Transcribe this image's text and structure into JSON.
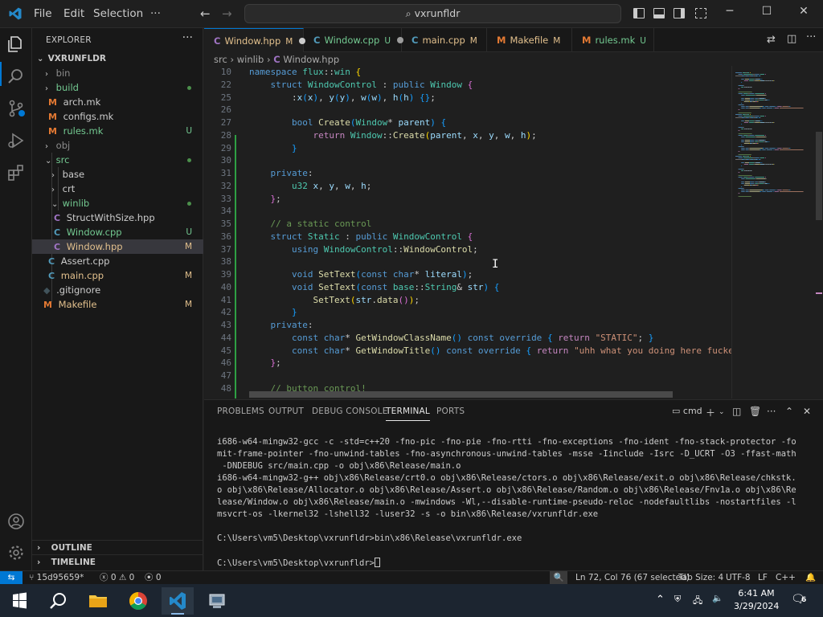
{
  "titlebar": {
    "menu": [
      "File",
      "Edit",
      "Selection",
      "···"
    ],
    "search": "vxrunfldr"
  },
  "sidebar": {
    "header": "EXPLORER",
    "root": "VXRUNFLDR",
    "items": [
      {
        "label": "bin",
        "kind": "folder",
        "state": "ignored",
        "badge": ""
      },
      {
        "label": "build",
        "kind": "folder",
        "state": "new",
        "badge": "dot"
      },
      {
        "label": "arch.mk",
        "kind": "file",
        "state": "plain",
        "badge": ""
      },
      {
        "label": "configs.mk",
        "kind": "file",
        "state": "plain",
        "badge": ""
      },
      {
        "label": "rules.mk",
        "kind": "file",
        "state": "new",
        "badge": "U"
      },
      {
        "label": "obj",
        "kind": "folder",
        "state": "ignored",
        "badge": ""
      },
      {
        "label": "src",
        "kind": "folder",
        "state": "new",
        "badge": "dot"
      },
      {
        "label": "base",
        "kind": "folder",
        "state": "plain",
        "badge": ""
      },
      {
        "label": "crt",
        "kind": "folder",
        "state": "plain",
        "badge": ""
      },
      {
        "label": "winlib",
        "kind": "folder",
        "state": "new",
        "badge": "dot"
      },
      {
        "label": "StructWithSize.hpp",
        "kind": "file",
        "state": "plain",
        "badge": ""
      },
      {
        "label": "Window.cpp",
        "kind": "file",
        "state": "new",
        "badge": "U"
      },
      {
        "label": "Window.hpp",
        "kind": "file",
        "state": "mod",
        "badge": "M"
      },
      {
        "label": "Assert.cpp",
        "kind": "file",
        "state": "plain",
        "badge": ""
      },
      {
        "label": "main.cpp",
        "kind": "file",
        "state": "mod",
        "badge": "M"
      },
      {
        "label": ".gitignore",
        "kind": "file",
        "state": "plain",
        "badge": ""
      },
      {
        "label": "Makefile",
        "kind": "file",
        "state": "mod",
        "badge": "M"
      }
    ],
    "outline": "OUTLINE",
    "timeline": "TIMELINE"
  },
  "tabs": [
    {
      "label": "Window.hpp",
      "status": "M"
    },
    {
      "label": "Window.cpp",
      "status": "U"
    },
    {
      "label": "main.cpp",
      "status": "M"
    },
    {
      "label": "Makefile",
      "status": "M"
    },
    {
      "label": "rules.mk",
      "status": "U"
    }
  ],
  "breadcrumb": [
    "src",
    "winlib",
    "Window.hpp"
  ],
  "editor": {
    "lines": [
      {
        "n": "10",
        "tokens": [
          [
            "kw",
            "namespace"
          ],
          [
            "p",
            " "
          ],
          [
            "ty",
            "flux"
          ],
          [
            "p",
            "::"
          ],
          [
            "ty",
            "win"
          ],
          [
            "p",
            " "
          ],
          [
            "br1",
            "{"
          ]
        ]
      },
      {
        "n": "22",
        "tokens": [
          [
            "p",
            "    "
          ],
          [
            "kw",
            "struct"
          ],
          [
            "p",
            " "
          ],
          [
            "ty",
            "WindowControl"
          ],
          [
            "p",
            " : "
          ],
          [
            "kw",
            "public"
          ],
          [
            "p",
            " "
          ],
          [
            "ty",
            "Window"
          ],
          [
            "p",
            " "
          ],
          [
            "br2",
            "{"
          ]
        ]
      },
      {
        "n": "25",
        "tokens": [
          [
            "p",
            "        :"
          ],
          [
            "var",
            "x"
          ],
          [
            "br3",
            "("
          ],
          [
            "var",
            "x"
          ],
          [
            "br3",
            ")"
          ],
          [
            "p",
            ", "
          ],
          [
            "var",
            "y"
          ],
          [
            "br3",
            "("
          ],
          [
            "var",
            "y"
          ],
          [
            "br3",
            ")"
          ],
          [
            "p",
            ", "
          ],
          [
            "var",
            "w"
          ],
          [
            "br3",
            "("
          ],
          [
            "var",
            "w"
          ],
          [
            "br3",
            ")"
          ],
          [
            "p",
            ", "
          ],
          [
            "var",
            "h"
          ],
          [
            "br3",
            "("
          ],
          [
            "var",
            "h"
          ],
          [
            "br3",
            ")"
          ],
          [
            "p",
            " "
          ],
          [
            "br3",
            "{}"
          ],
          [
            "p",
            ";"
          ]
        ]
      },
      {
        "n": "26",
        "tokens": []
      },
      {
        "n": "27",
        "tokens": [
          [
            "p",
            "        "
          ],
          [
            "kw",
            "bool"
          ],
          [
            "p",
            " "
          ],
          [
            "fn",
            "Create"
          ],
          [
            "br3",
            "("
          ],
          [
            "ty",
            "Window"
          ],
          [
            "p",
            "* "
          ],
          [
            "var",
            "parent"
          ],
          [
            "br3",
            ")"
          ],
          [
            "p",
            " "
          ],
          [
            "br3",
            "{"
          ]
        ]
      },
      {
        "n": "28",
        "tokens": [
          [
            "p",
            "            "
          ],
          [
            "ctl",
            "return"
          ],
          [
            "p",
            " "
          ],
          [
            "ty",
            "Window"
          ],
          [
            "p",
            "::"
          ],
          [
            "fn",
            "Create"
          ],
          [
            "br1",
            "("
          ],
          [
            "var",
            "parent"
          ],
          [
            "p",
            ", "
          ],
          [
            "var",
            "x"
          ],
          [
            "p",
            ", "
          ],
          [
            "var",
            "y"
          ],
          [
            "p",
            ", "
          ],
          [
            "var",
            "w"
          ],
          [
            "p",
            ", "
          ],
          [
            "var",
            "h"
          ],
          [
            "br1",
            ")"
          ],
          [
            "p",
            ";"
          ]
        ]
      },
      {
        "n": "29",
        "tokens": [
          [
            "p",
            "        "
          ],
          [
            "br3",
            "}"
          ]
        ]
      },
      {
        "n": "30",
        "tokens": []
      },
      {
        "n": "31",
        "tokens": [
          [
            "p",
            "    "
          ],
          [
            "kw",
            "private"
          ],
          [
            "p",
            ":"
          ]
        ]
      },
      {
        "n": "32",
        "tokens": [
          [
            "p",
            "        "
          ],
          [
            "ty",
            "u32"
          ],
          [
            "p",
            " "
          ],
          [
            "var",
            "x"
          ],
          [
            "p",
            ", "
          ],
          [
            "var",
            "y"
          ],
          [
            "p",
            ", "
          ],
          [
            "var",
            "w"
          ],
          [
            "p",
            ", "
          ],
          [
            "var",
            "h"
          ],
          [
            "p",
            ";"
          ]
        ]
      },
      {
        "n": "33",
        "tokens": [
          [
            "p",
            "    "
          ],
          [
            "br2",
            "}"
          ],
          [
            "p",
            ";"
          ]
        ]
      },
      {
        "n": "34",
        "tokens": []
      },
      {
        "n": "35",
        "tokens": [
          [
            "p",
            "    "
          ],
          [
            "com",
            "// a static control"
          ]
        ]
      },
      {
        "n": "36",
        "tokens": [
          [
            "p",
            "    "
          ],
          [
            "kw",
            "struct"
          ],
          [
            "p",
            " "
          ],
          [
            "ty",
            "Static"
          ],
          [
            "p",
            " : "
          ],
          [
            "kw",
            "public"
          ],
          [
            "p",
            " "
          ],
          [
            "ty",
            "WindowControl"
          ],
          [
            "p",
            " "
          ],
          [
            "br2",
            "{"
          ]
        ]
      },
      {
        "n": "37",
        "tokens": [
          [
            "p",
            "        "
          ],
          [
            "kw",
            "using"
          ],
          [
            "p",
            " "
          ],
          [
            "ty",
            "WindowControl"
          ],
          [
            "p",
            "::"
          ],
          [
            "fn",
            "WindowControl"
          ],
          [
            "p",
            ";"
          ]
        ]
      },
      {
        "n": "38",
        "tokens": []
      },
      {
        "n": "39",
        "tokens": [
          [
            "p",
            "        "
          ],
          [
            "kw",
            "void"
          ],
          [
            "p",
            " "
          ],
          [
            "fn",
            "SetText"
          ],
          [
            "br3",
            "("
          ],
          [
            "kw",
            "const"
          ],
          [
            "p",
            " "
          ],
          [
            "kw",
            "char"
          ],
          [
            "p",
            "* "
          ],
          [
            "var",
            "literal"
          ],
          [
            "br3",
            ")"
          ],
          [
            "p",
            ";"
          ]
        ]
      },
      {
        "n": "40",
        "tokens": [
          [
            "p",
            "        "
          ],
          [
            "kw",
            "void"
          ],
          [
            "p",
            " "
          ],
          [
            "fn",
            "SetText"
          ],
          [
            "br3",
            "("
          ],
          [
            "kw",
            "const"
          ],
          [
            "p",
            " "
          ],
          [
            "ty",
            "base"
          ],
          [
            "p",
            "::"
          ],
          [
            "ty",
            "String"
          ],
          [
            "p",
            "& "
          ],
          [
            "var",
            "str"
          ],
          [
            "br3",
            ")"
          ],
          [
            "p",
            " "
          ],
          [
            "br3",
            "{"
          ]
        ]
      },
      {
        "n": "41",
        "tokens": [
          [
            "p",
            "            "
          ],
          [
            "fn",
            "SetText"
          ],
          [
            "br1",
            "("
          ],
          [
            "var",
            "str"
          ],
          [
            "p",
            "."
          ],
          [
            "fn",
            "data"
          ],
          [
            "br2",
            "()"
          ],
          [
            "br1",
            ")"
          ],
          [
            "p",
            ";"
          ]
        ]
      },
      {
        "n": "42",
        "tokens": [
          [
            "p",
            "        "
          ],
          [
            "br3",
            "}"
          ]
        ]
      },
      {
        "n": "43",
        "tokens": [
          [
            "p",
            "    "
          ],
          [
            "kw",
            "private"
          ],
          [
            "p",
            ":"
          ]
        ]
      },
      {
        "n": "44",
        "tokens": [
          [
            "p",
            "        "
          ],
          [
            "kw",
            "const"
          ],
          [
            "p",
            " "
          ],
          [
            "kw",
            "char"
          ],
          [
            "p",
            "* "
          ],
          [
            "fn",
            "GetWindowClassName"
          ],
          [
            "br3",
            "()"
          ],
          [
            "p",
            " "
          ],
          [
            "kw",
            "const"
          ],
          [
            "p",
            " "
          ],
          [
            "kw",
            "override"
          ],
          [
            "p",
            " "
          ],
          [
            "br3",
            "{"
          ],
          [
            "p",
            " "
          ],
          [
            "ctl",
            "return"
          ],
          [
            "p",
            " "
          ],
          [
            "str",
            "\"STATIC\""
          ],
          [
            "p",
            "; "
          ],
          [
            "br3",
            "}"
          ]
        ]
      },
      {
        "n": "45",
        "tokens": [
          [
            "p",
            "        "
          ],
          [
            "kw",
            "const"
          ],
          [
            "p",
            " "
          ],
          [
            "kw",
            "char"
          ],
          [
            "p",
            "* "
          ],
          [
            "fn",
            "GetWindowTitle"
          ],
          [
            "br3",
            "()"
          ],
          [
            "p",
            " "
          ],
          [
            "kw",
            "const"
          ],
          [
            "p",
            " "
          ],
          [
            "kw",
            "override"
          ],
          [
            "p",
            " "
          ],
          [
            "br3",
            "{"
          ],
          [
            "p",
            " "
          ],
          [
            "ctl",
            "return"
          ],
          [
            "p",
            " "
          ],
          [
            "str",
            "\"uhh what you doing here fucker g"
          ]
        ]
      },
      {
        "n": "46",
        "tokens": [
          [
            "p",
            "    "
          ],
          [
            "br2",
            "}"
          ],
          [
            "p",
            ";"
          ]
        ]
      },
      {
        "n": "47",
        "tokens": []
      },
      {
        "n": "48",
        "tokens": [
          [
            "p",
            "    "
          ],
          [
            "com",
            "// button control!"
          ]
        ]
      }
    ]
  },
  "panel": {
    "tabs": [
      "PROBLEMS",
      "OUTPUT",
      "DEBUG CONSOLE",
      "TERMINAL",
      "PORTS"
    ],
    "active_tab": "TERMINAL",
    "shell": "cmd",
    "terminal_lines": [
      "i686-w64-mingw32-gcc -c -std=c++20 -fno-pic -fno-pie -fno-rtti -fno-exceptions -fno-ident -fno-stack-protector -fo",
      "mit-frame-pointer -fno-unwind-tables -fno-asynchronous-unwind-tables -msse -Iinclude -Isrc -D_UCRT -O3 -ffast-math",
      " -DNDEBUG src/main.cpp -o obj\\x86\\Release/main.o",
      "i686-w64-mingw32-g++ obj\\x86\\Release/crt0.o obj\\x86\\Release/ctors.o obj\\x86\\Release/exit.o obj\\x86\\Release/chkstk.",
      "o obj\\x86\\Release/Allocator.o obj\\x86\\Release/Assert.o obj\\x86\\Release/Random.o obj\\x86\\Release/Fnv1a.o obj\\x86\\Re",
      "lease/Window.o obj\\x86\\Release/main.o -mwindows -Wl,--disable-runtime-pseudo-reloc -nodefaultlibs -nostartfiles -l",
      "msvcrt-os -lkernel32 -lshell32 -luser32 -s -o bin\\x86\\Release/vxrunfldr.exe",
      "",
      "C:\\Users\\vm5\\Desktop\\vxrunfldr>bin\\x86\\Release\\vxrunfldr.exe",
      "",
      "C:\\Users\\vm5\\Desktop\\vxrunfldr>"
    ]
  },
  "statusbar": {
    "branch": "15d95659*",
    "errors": "0",
    "warnings": "0",
    "ports": "0",
    "cursor": "Ln 72, Col 76 (67 selected)",
    "tab_size": "Tab Size: 4",
    "encoding": "UTF-8",
    "eol": "LF",
    "language": "C++"
  },
  "taskbar": {
    "time": "6:41 AM",
    "date": "3/29/2024",
    "notifications": "6"
  },
  "colors": {
    "accent": "#0078d4",
    "modified": "#e2c08d",
    "untracked": "#73c991"
  }
}
